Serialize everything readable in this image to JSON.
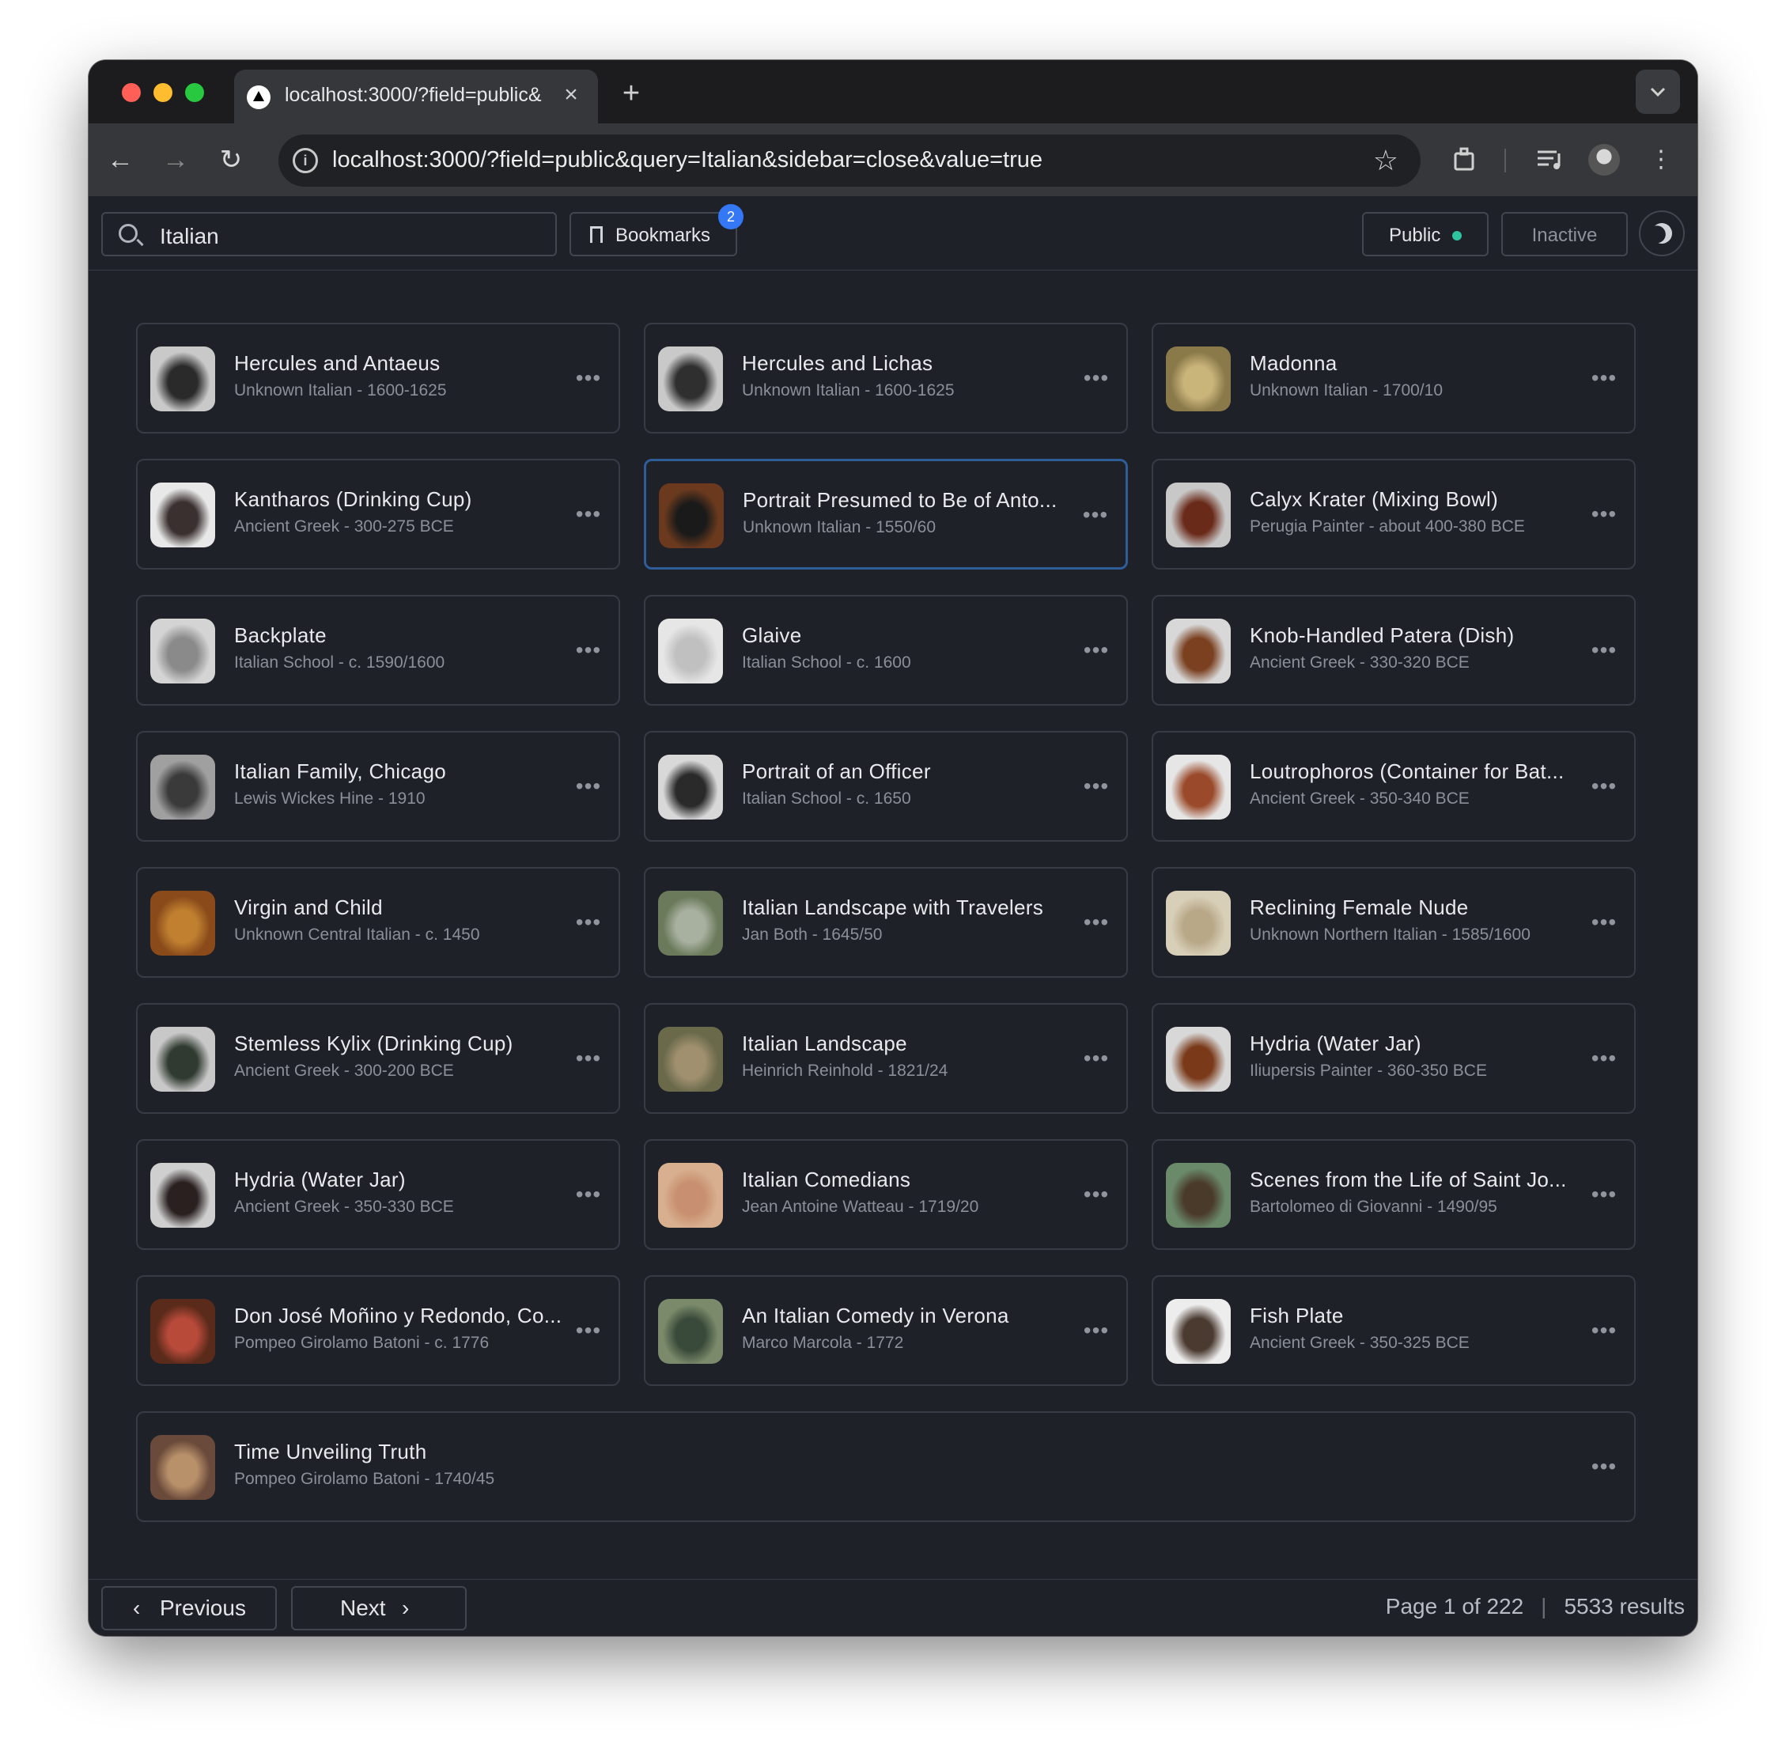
{
  "browser": {
    "tab_title": "localhost:3000/?field=public&",
    "url": "localhost:3000/?field=public&query=Italian&sidebar=close&value=true"
  },
  "header": {
    "search_value": "Italian",
    "bookmarks_label": "Bookmarks",
    "bookmarks_count": "2",
    "public_label": "Public",
    "inactive_label": "Inactive"
  },
  "cards": [
    {
      "title": "Hercules and Antaeus",
      "subtitle": "Unknown Italian - 1600-1625"
    },
    {
      "title": "Hercules and Lichas",
      "subtitle": "Unknown Italian - 1600-1625"
    },
    {
      "title": "Madonna",
      "subtitle": "Unknown Italian - 1700/10"
    },
    {
      "title": "Kantharos (Drinking Cup)",
      "subtitle": "Ancient Greek - 300-275 BCE"
    },
    {
      "title": "Portrait Presumed to Be of Anto...",
      "subtitle": "Unknown Italian - 1550/60"
    },
    {
      "title": "Calyx Krater (Mixing Bowl)",
      "subtitle": "Perugia Painter - about 400-380 BCE"
    },
    {
      "title": "Backplate",
      "subtitle": "Italian School - c. 1590/1600"
    },
    {
      "title": "Glaive",
      "subtitle": "Italian School - c. 1600"
    },
    {
      "title": "Knob-Handled Patera (Dish)",
      "subtitle": "Ancient Greek - 330-320 BCE"
    },
    {
      "title": "Italian Family, Chicago",
      "subtitle": "Lewis Wickes Hine - 1910"
    },
    {
      "title": "Portrait of an Officer",
      "subtitle": "Italian School - c. 1650"
    },
    {
      "title": "Loutrophoros (Container for Bat...",
      "subtitle": "Ancient Greek - 350-340 BCE"
    },
    {
      "title": "Virgin and Child",
      "subtitle": "Unknown Central Italian - c. 1450"
    },
    {
      "title": "Italian Landscape with Travelers",
      "subtitle": "Jan Both - 1645/50"
    },
    {
      "title": "Reclining Female Nude",
      "subtitle": "Unknown Northern Italian - 1585/1600"
    },
    {
      "title": "Stemless Kylix (Drinking Cup)",
      "subtitle": "Ancient Greek - 300-200 BCE"
    },
    {
      "title": "Italian Landscape",
      "subtitle": "Heinrich Reinhold - 1821/24"
    },
    {
      "title": "Hydria (Water Jar)",
      "subtitle": "Iliupersis Painter - 360-350 BCE"
    },
    {
      "title": "Hydria (Water Jar)",
      "subtitle": "Ancient Greek - 350-330 BCE"
    },
    {
      "title": "Italian Comedians",
      "subtitle": "Jean Antoine Watteau - 1719/20"
    },
    {
      "title": "Scenes from the Life of Saint Jo...",
      "subtitle": "Bartolomeo di Giovanni - 1490/95"
    },
    {
      "title": "Don José Moñino y Redondo, Co...",
      "subtitle": "Pompeo Girolamo Batoni - c. 1776"
    },
    {
      "title": "An Italian Comedy in Verona",
      "subtitle": "Marco Marcola - 1772"
    },
    {
      "title": "Fish Plate",
      "subtitle": "Ancient Greek - 350-325 BCE"
    },
    {
      "title": "Time Unveiling Truth",
      "subtitle": "Pompeo Girolamo Batoni - 1740/45"
    }
  ],
  "footer": {
    "previous_label": "Previous",
    "next_label": "Next",
    "page_info": "Page 1 of 222",
    "results": "5533 results"
  },
  "colors": {
    "background": "#1e2128",
    "card_border": "#363b45",
    "selected_border": "#2f5d97",
    "badge": "#3478f6",
    "status_dot": "#2ec4a0"
  }
}
